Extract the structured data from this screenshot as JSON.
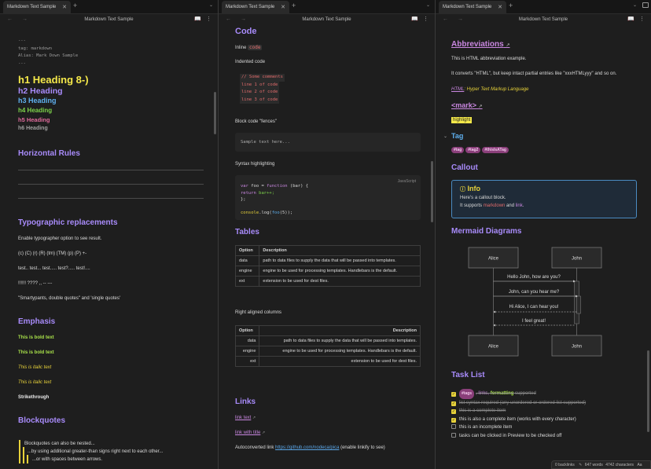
{
  "tab_title": "Markdown Text Sample",
  "note_title": "Markdown Text Sample",
  "pane1": {
    "frontmatter": [
      "---",
      "tag: markdown",
      "Alias: Mark Down Sample",
      "---"
    ],
    "h1": "h1 Heading 8-)",
    "h2": "h2 Heading",
    "h3": "h3 Heading",
    "h4": "h4 Heading",
    "h5": "h5 Heading",
    "h6": "h6 Heading",
    "horizontal_rules": "Horizontal Rules",
    "typographic": "Typographic replacements",
    "typo_intro": "Enable typographer option to see result.",
    "typo_line1": "(c) (C) (r) (R) (tm) (TM) (p) (P) +-",
    "typo_line2": "test.. test... test..... test?..... test!....",
    "typo_line3": "!!!!!! ???? ,, -- ---",
    "typo_line4": "\"Smartypants, double quotes\" and 'single quotes'",
    "emphasis": "Emphasis",
    "bold1": "This is bold text",
    "bold2": "This is bold text",
    "italic1": "This is italic text",
    "italic2": "This is italic text",
    "strike": "Strikethrough",
    "blockquotes": "Blockquotes",
    "bq1": "Blockquotes can also be nested...",
    "bq2": "...by using additional greater-than signs right next to each other...",
    "bq3": "...or with spaces between arrows."
  },
  "pane2": {
    "code_heading": "Code",
    "inline_prefix": "Inline ",
    "inline_code": "code",
    "indented": "Indented code",
    "indented_lines": [
      "// Some comments",
      "line 1 of code",
      "line 2 of code",
      "line 3 of code"
    ],
    "block_fences": "Block code \"fences\"",
    "fence_sample": "Sample text here...",
    "syntax": "Syntax highlighting",
    "lang": "JavaScript",
    "js": {
      "l1a": "var",
      "l1b": " foo = ",
      "l1c": "function",
      "l1d": " (bar) {",
      "l2a": "  return",
      "l2b": " bar++;",
      "l3": "};",
      "l5a": "console",
      "l5b": ".log(",
      "l5c": "foo",
      "l5d": "(5));"
    },
    "tables": "Tables",
    "th_option": "Option",
    "th_desc": "Description",
    "rows": [
      {
        "opt": "data",
        "desc": "path to data files to supply the data that will be passed into templates."
      },
      {
        "opt": "engine",
        "desc": "engine to be used for processing templates. Handlebars is the default."
      },
      {
        "opt": "ext",
        "desc": "extension to be used for dest files."
      }
    ],
    "right_aligned": "Right aligned columns",
    "rows2": [
      {
        "opt": "data",
        "desc": "path to data files to supply the data that will be passed into templates."
      },
      {
        "opt": "engine",
        "desc": "engine to be used for processing templates. Handlebars is the default."
      },
      {
        "opt": "ext",
        "desc": "extension to be used for dest files."
      }
    ],
    "links": "Links",
    "link_text": "link text",
    "link_title": "link with title",
    "autoconv_prefix": "Autoconverted link ",
    "autoconv_url": "https://github.com/nodeca/pica",
    "autoconv_suffix": " (enable linkify to see)"
  },
  "pane3": {
    "abbreviations": "Abbreviations",
    "abbr_line1": "This is HTML abbreviation example.",
    "abbr_line2": "It converts \"HTML\", but keep intact partial entries like \"xxxHTMLyyy\" and so on.",
    "abbr_def_term": "HTML",
    "abbr_def_rest": ": Hyper Text Markup Language",
    "mark_heading": "<mark>",
    "highlight": "highlight",
    "tag_heading": "Tag",
    "tags": [
      "#tag",
      "#tag2",
      "#thisIsATag"
    ],
    "callout_heading": "Callout",
    "callout_title": "Info",
    "callout_line1": "Here's a callout block.",
    "callout_line2a": "It supports ",
    "callout_line2b": "markdown",
    "callout_line2c": " and ",
    "callout_line2d": "link",
    ".": ".",
    "callout_dot": ".",
    "mermaid_heading": "Mermaid Diagrams",
    "actor_a": "Alice",
    "actor_b": "John",
    "msg1": "Hello John, how are you?",
    "msg2": "John, can you hear me?",
    "msg3": "Hi Alice, I can hear you!",
    "msg4": "I feel great!",
    "tasklist_heading": "Task List",
    "task1_tag": "#tags",
    "task1_links": ", links,",
    "task1_fmt": " formatting",
    "task1_rest": " supported",
    "task2": "list syntax required (any unordered or ordered list supported)",
    "task3": "this is a complete item",
    "task4": "this is also a complete item (works with every character)",
    "task5": "this is an incomplete item",
    "task6": "tasks can be clicked in Preview to be checked off"
  },
  "status": {
    "backlinks": "0 backlinks",
    "words": "647 words",
    "chars": "4742 characters",
    "aa": "Aa"
  },
  "colors": {
    "h1": "#f5e94a",
    "h2": "#a88bfa",
    "h3": "#5fb0ef",
    "h4": "#7dd34a",
    "h5": "#e06b9c",
    "h6": "#a0a0a0",
    "accent": "#c987e0",
    "highlight": "#f5e94a"
  }
}
